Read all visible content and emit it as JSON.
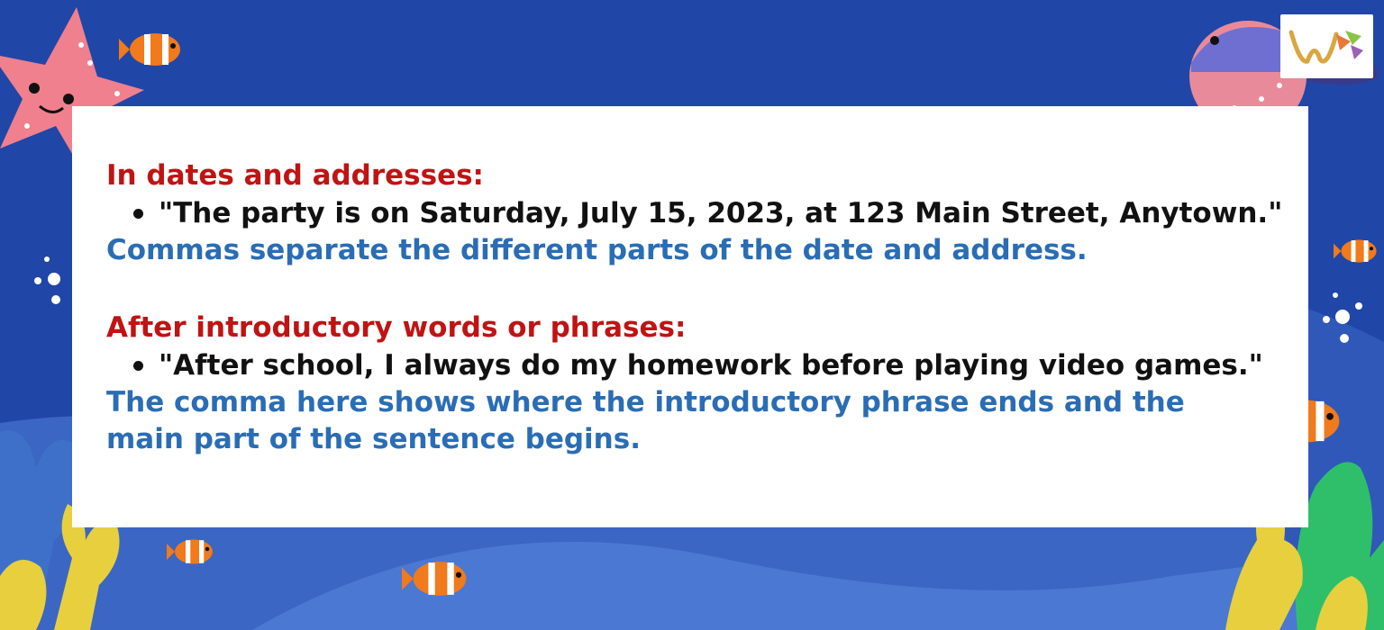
{
  "sections": [
    {
      "heading": "In dates and addresses:",
      "example": "\"The party is on Saturday, July 15, 2023, at 123 Main Street, Anytown.\"",
      "note": "Commas separate the different parts of the date and address."
    },
    {
      "heading": "After introductory words or phrases:",
      "example": "\"After school, I always do my homework before playing video games.\"",
      "note": "The comma here shows where the introductory phrase ends and the main part of the sentence begins."
    }
  ],
  "colors": {
    "background": "#2046a8",
    "heading": "#c01313",
    "example": "#111111",
    "note": "#2a6db5",
    "card": "#ffffff"
  },
  "icons": [
    "starfish-icon",
    "clownfish-icon",
    "pufferfish-icon",
    "coral-icon",
    "bubbles-icon",
    "logo-icon"
  ]
}
